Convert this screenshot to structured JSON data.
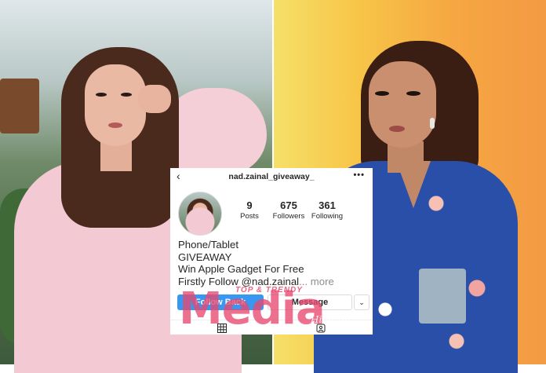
{
  "profile": {
    "username": "nad.zainal_giveaway_",
    "posts_count": "9",
    "posts_label": "Posts",
    "followers_count": "675",
    "followers_label": "Followers",
    "following_count": "361",
    "following_label": "Following",
    "bio": {
      "line1": "Phone/Tablet",
      "line2": "GIVEAWAY",
      "line3": "Win Apple Gadget For Free",
      "line4": "Firstly Follow @nad.zainal",
      "more": "... more"
    },
    "buttons": {
      "follow_back": "Follow Back",
      "message": "Message"
    }
  },
  "icons": {
    "back": "chevron-left-icon",
    "more": "more-horizontal-icon",
    "dropdown": "chevron-down-icon",
    "grid": "grid-icon",
    "tagged": "tagged-icon"
  },
  "watermark": {
    "main": "Media",
    "top": "TOP & TRENDY",
    "sub": "Hiburan"
  },
  "colors": {
    "follow_button": "#3897f0",
    "watermark": "#e8486e"
  }
}
